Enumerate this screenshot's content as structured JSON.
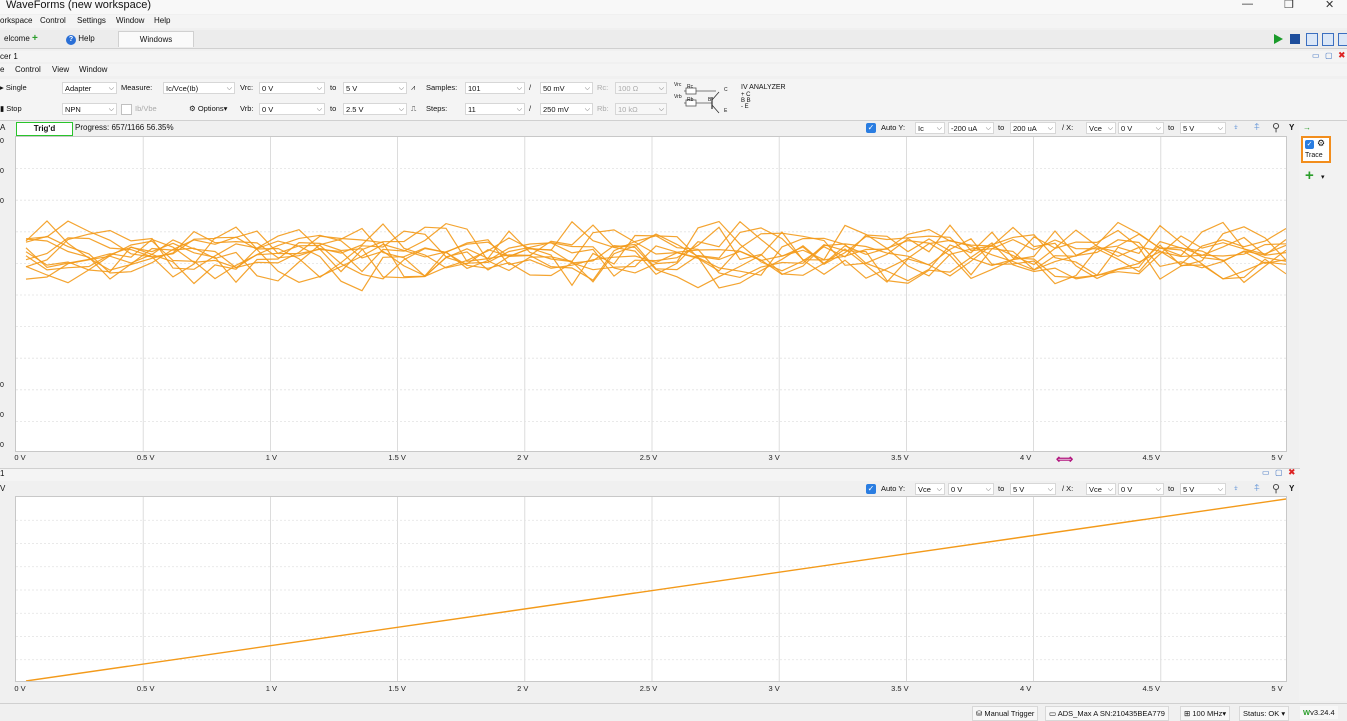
{
  "app": {
    "title": "WaveForms (new workspace)"
  },
  "menu": [
    "orkspace",
    "Control",
    "Settings",
    "Window",
    "Help"
  ],
  "tabs": {
    "welcome": "elcome",
    "help": "Help",
    "windows": "Windows"
  },
  "instrument": {
    "name": "cer 1"
  },
  "submenu": [
    "e",
    "Control",
    "View",
    "Window"
  ],
  "toolbar": {
    "single": "Single",
    "stop": "Stop",
    "adapter": "Adapter",
    "npn": "NPN",
    "measure_label": "Measure:",
    "measure_value": "Ic/Vce(Ib)",
    "ib_vbe": "Ib/Vbe",
    "options": "Options",
    "vrc_label": "Vrc:",
    "vrc_from": "0 V",
    "vrc_to_label": "to",
    "vrc_to": "5 V",
    "vrb_label": "Vrb:",
    "vrb_from": "0 V",
    "vrb_to_label": "to",
    "vrb_to": "2.5 V",
    "samples_label": "Samples:",
    "samples_value": "101",
    "samples_slash": "/",
    "samples_step": "50 mV",
    "steps_label": "Steps:",
    "steps_value": "11",
    "steps_slash": "/",
    "steps_step": "250 mV",
    "rc_label": "Rc:",
    "rc_value": "100 Ω",
    "rb_label": "Rb:",
    "rb_value": "10 kΩ",
    "circuit": {
      "vrc": "Vrc",
      "rc": "Rc",
      "vrb": "Vrb",
      "rb": "Rb",
      "c": "C",
      "b": "B",
      "e": "E"
    },
    "iv_title": "IV ANALYZER",
    "iv_legend": [
      "+ C",
      "B  B",
      "- E"
    ]
  },
  "status": {
    "trig": "Trig'd",
    "progress": "Progress: 657/1166 56.35%",
    "left_letter": "A"
  },
  "plot1": {
    "autoy_label": "Auto Y:",
    "y_var": "Ic",
    "y_from": "-200 uA",
    "y_to_label": "to",
    "y_to": "200 uA",
    "x_sep": "/ X:",
    "x_var": "Vce",
    "x_from": "0 V",
    "x_to_label": "to",
    "x_to": "5 V",
    "y_btn": "Y",
    "left_ticks": [
      "0",
      "0",
      "0",
      "0",
      "0",
      "0"
    ],
    "x_ticks": [
      "0 V",
      "0.5 V",
      "1 V",
      "1.5 V",
      "2 V",
      "2.5 V",
      "3 V",
      "3.5 V",
      "4 V",
      "4.5 V",
      "5 V"
    ]
  },
  "plot2": {
    "title": "1",
    "left_letter": "V",
    "autoy_label": "Auto Y:",
    "y_var": "Vce",
    "y_from": "0 V",
    "y_to_label": "to",
    "y_to": "5 V",
    "x_sep": "/ X:",
    "x_var": "Vce",
    "x_from": "0 V",
    "x_to_label": "to",
    "x_to": "5 V",
    "y_btn": "Y",
    "x_ticks": [
      "0 V",
      "0.5 V",
      "1 V",
      "1.5 V",
      "2 V",
      "2.5 V",
      "3 V",
      "3.5 V",
      "4 V",
      "4.5 V",
      "5 V"
    ]
  },
  "side": {
    "trace": "Trace"
  },
  "statusbar": {
    "manual_trigger": "Manual Trigger",
    "device": "ADS_Max A SN:210435BEA779",
    "clock": "100 MHz",
    "status": "Status: OK",
    "version": "v3.24.4"
  },
  "colors": {
    "trace": "#f39a1a",
    "grid": "#d4d4d4",
    "trig_border": "#29c42b",
    "accent_run": "#1a9b2a",
    "highlight": "#f28d1c",
    "marker": "#b2147e"
  }
}
